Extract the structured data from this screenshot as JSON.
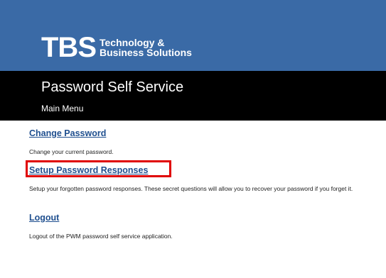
{
  "logo": {
    "mark": "TBS",
    "line1": "Technology &",
    "line2": "Business Solutions"
  },
  "header": {
    "title": "Password Self Service",
    "subtitle": "Main Menu"
  },
  "menu": {
    "items": [
      {
        "label": "Change Password",
        "description": "Change your current password."
      },
      {
        "label": "Setup Password Responses",
        "description": "Setup your forgotten password responses. These secret questions will allow you to recover your password if you forget it."
      },
      {
        "label": "Logout",
        "description": "Logout of the PWM password self service application."
      }
    ]
  },
  "colors": {
    "header_bg": "#3a6aa6",
    "title_bar_bg": "#000000",
    "link": "#1f4f8f",
    "highlight": "#e00000"
  }
}
